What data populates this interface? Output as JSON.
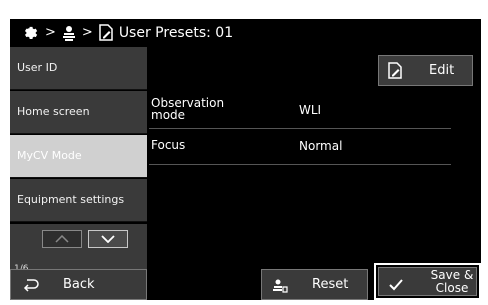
{
  "breadcrumb": {
    "separator": ">",
    "title": "User Presets: 01"
  },
  "sidebar": {
    "items": [
      {
        "label": "User ID"
      },
      {
        "label": "Home screen"
      },
      {
        "label": "MyCV Mode",
        "selected": true
      },
      {
        "label": "Equipment settings"
      }
    ],
    "page": "1/6"
  },
  "toolbar": {
    "edit_label": "Edit"
  },
  "settings": [
    {
      "name": "Observation mode",
      "value": "WLI"
    },
    {
      "name": "Focus",
      "value": "Normal"
    }
  ],
  "bottom": {
    "back_label": "Back",
    "reset_label": "Reset",
    "save_label": "Save & Close"
  },
  "colors": {
    "background": "#000000",
    "button": "#3a3a3a",
    "selected": "#d0d0d0",
    "text": "#ffffff"
  }
}
